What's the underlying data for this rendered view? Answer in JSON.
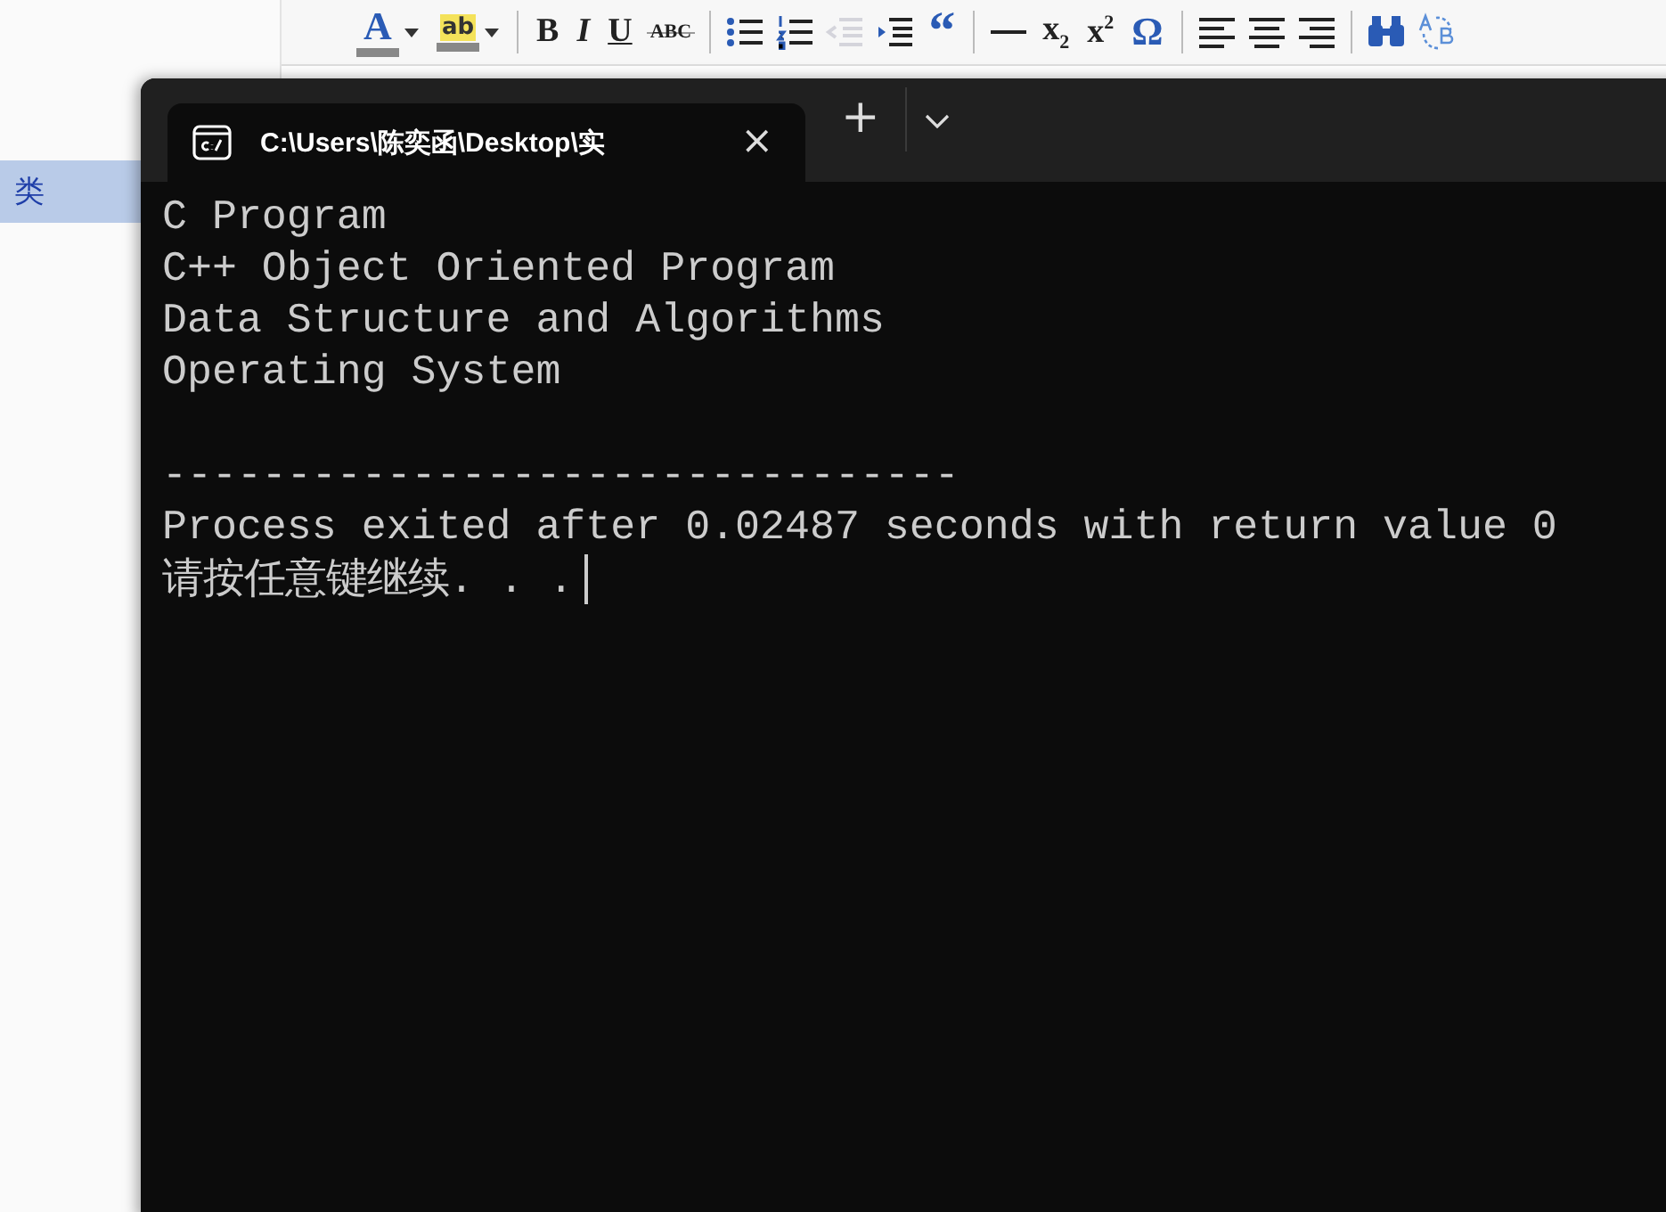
{
  "toolbar": [
    {
      "kind": "font-color",
      "label": "A",
      "disabled": false
    },
    {
      "kind": "highlight",
      "label": "ab",
      "disabled": false
    },
    {
      "kind": "sep"
    },
    {
      "kind": "bold",
      "label": "B",
      "disabled": false
    },
    {
      "kind": "italic",
      "label": "I",
      "disabled": false
    },
    {
      "kind": "underline",
      "label": "U",
      "disabled": false
    },
    {
      "kind": "strike",
      "label": "ABC",
      "disabled": false
    },
    {
      "kind": "sep"
    },
    {
      "kind": "bullets",
      "disabled": false
    },
    {
      "kind": "numbered",
      "disabled": false
    },
    {
      "kind": "outdent",
      "disabled": true
    },
    {
      "kind": "indent",
      "disabled": false
    },
    {
      "kind": "quote",
      "label": "“",
      "disabled": false
    },
    {
      "kind": "sep"
    },
    {
      "kind": "rule",
      "disabled": false
    },
    {
      "kind": "glyph",
      "label": "x$_{2}$",
      "disabled": false
    },
    {
      "kind": "glyph",
      "label": "x$^{2}$",
      "disabled": false
    },
    {
      "kind": "omega",
      "label": "Ω",
      "disabled": false
    },
    {
      "kind": "sep"
    },
    {
      "kind": "align-left",
      "disabled": false
    },
    {
      "kind": "align-center",
      "disabled": false
    },
    {
      "kind": "align-right",
      "disabled": false
    },
    {
      "kind": "sep"
    },
    {
      "kind": "find",
      "disabled": false
    },
    {
      "kind": "replace",
      "disabled": false
    }
  ],
  "sidebar": {
    "items": [
      {
        "label": "类",
        "selected": true
      }
    ]
  },
  "terminal": {
    "tab": {
      "title": "C:\\Users\\陈奕函\\Desktop\\实",
      "close": "×"
    },
    "new_tab": "+",
    "output_lines": [
      "C Program",
      "C++ Object Oriented Program",
      "Data Structure and Algorithms",
      "Operating System"
    ],
    "separator": "--------------------------------",
    "exit_message": "Process exited after 0.02487 seconds with return value 0",
    "prompt": "请按任意键继续. . ."
  }
}
